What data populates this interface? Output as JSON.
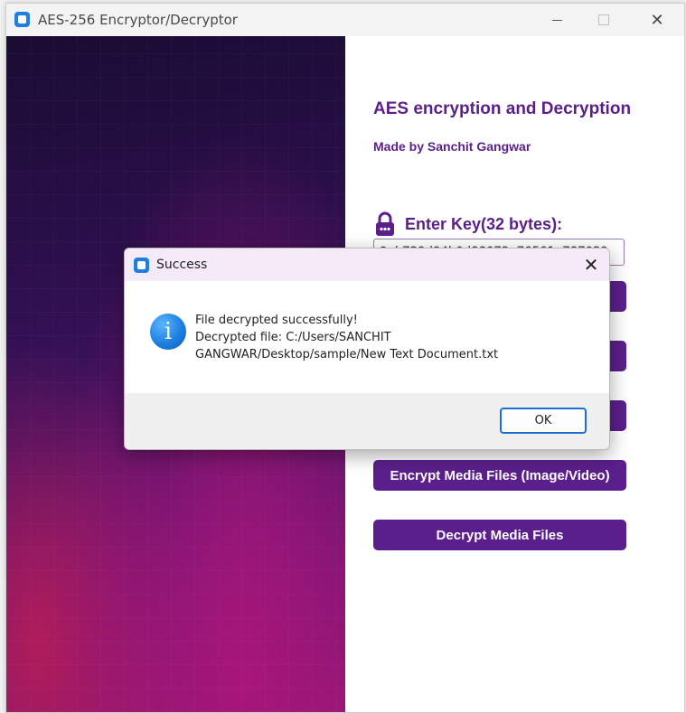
{
  "window": {
    "title": "AES-256 Encryptor/Decryptor",
    "minimize_icon": "minimize-icon",
    "maximize_icon": "maximize-icon",
    "close_glyph": "✕"
  },
  "form": {
    "heading": "AES encryption and Decryption",
    "byline": "Made by Sanchit Gangwar",
    "key_label": "Enter Key(32 bytes):",
    "key_icon": "lock-icon",
    "key_value": "9cb729d94b0d88073c76561e787039",
    "buttons": [
      "",
      "",
      "",
      "Encrypt Media Files (Image/Video)",
      "Decrypt Media Files"
    ]
  },
  "dialog": {
    "title": "Success",
    "icon": "info-icon",
    "info_glyph": "i",
    "message_line1": "File decrypted successfully!",
    "message_line2": "Decrypted file: C:/Users/SANCHIT GANGWAR/Desktop/sample/New Text Document.txt",
    "ok_label": "OK",
    "close_glyph": "✕"
  },
  "colors": {
    "accent": "#5a1f8c",
    "heading": "#5b1f8a",
    "dialog_title_bg": "#f5eaf8",
    "ok_border": "#1e6fd0"
  }
}
